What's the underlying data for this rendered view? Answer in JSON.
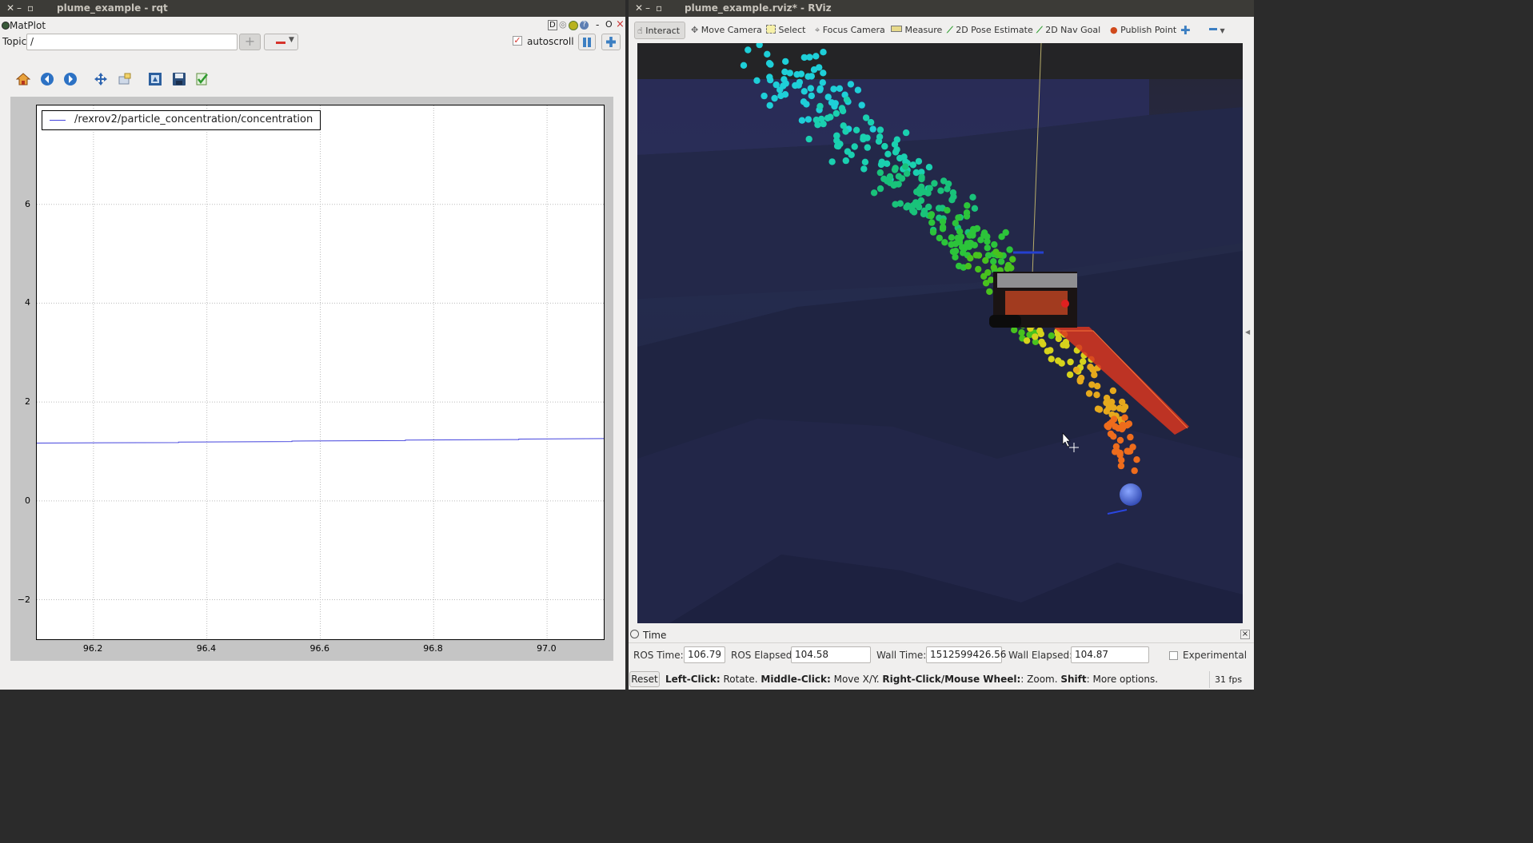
{
  "rqt": {
    "title": "plume_example - rqt",
    "plugin_name": "MatPlot",
    "plugin_buttons": [
      "D",
      "◎",
      "?",
      "-",
      "O",
      "×"
    ],
    "topic_label": "Topic",
    "topic_value": "/",
    "autoscroll_label": "autoscroll",
    "autoscroll_checked": true,
    "toolbar_icons": [
      "home-icon",
      "back-icon",
      "forward-icon",
      "pan-icon",
      "zoom-icon",
      "subplots-icon",
      "save-icon",
      "edit-icon"
    ]
  },
  "chart_data": {
    "type": "line",
    "title": "",
    "xlabel": "",
    "ylabel": "",
    "xlim": [
      96.1,
      97.1
    ],
    "ylim": [
      -2.8,
      8.0
    ],
    "xticks": [
      "96.2",
      "96.4",
      "96.6",
      "96.8",
      "97.0"
    ],
    "xtick_values": [
      96.2,
      96.4,
      96.6,
      96.8,
      97.0
    ],
    "yticks": [
      "−2",
      "0",
      "2",
      "4",
      "6"
    ],
    "ytick_values": [
      -2,
      0,
      2,
      4,
      6
    ],
    "grid": true,
    "legend_position": "top-left",
    "series": [
      {
        "name": "/rexrov2/particle_concentration/concentration",
        "color": "#4444dd",
        "x": [
          96.1,
          96.35,
          96.35,
          96.55,
          96.55,
          96.75,
          96.75,
          96.95,
          96.95,
          97.1
        ],
        "y": [
          1.17,
          1.18,
          1.19,
          1.2,
          1.21,
          1.22,
          1.23,
          1.24,
          1.25,
          1.26
        ]
      }
    ]
  },
  "rviz": {
    "title": "plume_example.rviz* - RViz",
    "tools": [
      "Interact",
      "Move Camera",
      "Select",
      "Focus Camera",
      "Measure",
      "2D Pose Estimate",
      "2D Nav Goal",
      "Publish Point"
    ],
    "time_panel_title": "Time",
    "ros_time_label": "ROS Time:",
    "ros_time": "106.79",
    "ros_elapsed_label": "ROS Elapsed:",
    "ros_elapsed": "104.58",
    "wall_time_label": "Wall Time:",
    "wall_time": "1512599426.56",
    "wall_elapsed_label": "Wall Elapsed:",
    "wall_elapsed": "104.87",
    "experimental_label": "Experimental",
    "reset_label": "Reset",
    "status_parts": [
      {
        "b": "Left-Click:",
        "t": " Rotate. "
      },
      {
        "b": "Middle-Click:",
        "t": " Move X/Y. "
      },
      {
        "b": "Right-Click/Mouse Wheel:",
        "t": ": Zoom. "
      },
      {
        "b": "Shift",
        "t": ": More options."
      }
    ],
    "fps": "31 fps"
  }
}
